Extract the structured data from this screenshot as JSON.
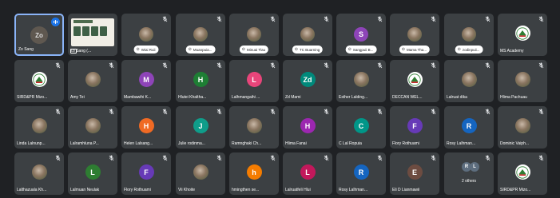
{
  "colors": {
    "background": "#1f2124",
    "tile": "#3c4043",
    "active_border": "#8ab4f8",
    "speaking": "#1a73e8"
  },
  "tiles": [
    {
      "id": "zo-sang",
      "label": "Zo Sang",
      "initials": "Zo",
      "avatar_color": "#5f5850",
      "kind": "initials",
      "state": "speaking",
      "active": true
    },
    {
      "id": "zo-sang-presentation",
      "label": "Zo Sang (...",
      "kind": "screen",
      "state": "none"
    },
    {
      "id": "wi-ai-rui",
      "label": "Wiai Ruii",
      "kind": "photo-pinned",
      "state": "muted"
    },
    {
      "id": "muanpuia",
      "label": "Muanpuia...",
      "kind": "photo-pinned",
      "state": "muted"
    },
    {
      "id": "minuai-tlau",
      "label": "Minuai Tlau",
      "kind": "photo-pinned",
      "state": "muted"
    },
    {
      "id": "tc-buarning",
      "label": "TC Buarning",
      "kind": "photo-pinned",
      "state": "muted"
    },
    {
      "id": "sangpuii",
      "label": "Sangpuii B...",
      "initials": "S",
      "avatar_color": "#8e44b8",
      "kind": "initials-pinned",
      "state": "muted"
    },
    {
      "id": "mama-tha",
      "label": "Mama Tha...",
      "kind": "photo-pinned",
      "state": "muted"
    },
    {
      "id": "zodinpuii",
      "label": "zodinpuii...",
      "kind": "photo-pinned",
      "state": "muted"
    },
    {
      "id": "ms-academy",
      "label": "MS Academy",
      "kind": "logo",
      "state": "muted"
    },
    {
      "id": "sirdpr-mizo",
      "label": "SIRD&PR Mizo...",
      "kind": "logo",
      "state": "muted"
    },
    {
      "id": "amy-tei",
      "label": "Amy Tei",
      "kind": "photo",
      "state": "muted"
    },
    {
      "id": "mambawihi",
      "label": "Mambawihi K...",
      "initials": "M",
      "avatar_color": "#8e44b8",
      "kind": "initials",
      "state": "muted"
    },
    {
      "id": "hlutei",
      "label": "Hlutei Khaltha...",
      "initials": "H",
      "avatar_color": "#1e7e34",
      "kind": "initials",
      "state": "muted"
    },
    {
      "id": "lalhmangaihi",
      "label": "Lalhmangaihi ...",
      "initials": "L",
      "avatar_color": "#e8457a",
      "kind": "initials",
      "state": "muted"
    },
    {
      "id": "zd-mami",
      "label": "Zd Mami",
      "initials": "Zd",
      "avatar_color": "#00897b",
      "kind": "initials",
      "state": "muted"
    },
    {
      "id": "esther",
      "label": "Esther Lalding...",
      "kind": "photo",
      "state": "muted"
    },
    {
      "id": "deccan",
      "label": "DECCAN WEL...",
      "kind": "logo",
      "state": "muted"
    },
    {
      "id": "lalruat-dika",
      "label": "Lalruat dika",
      "kind": "photo",
      "state": "muted"
    },
    {
      "id": "hlima-pachuau",
      "label": "Hlima Pachuau",
      "kind": "photo",
      "state": "muted"
    },
    {
      "id": "linda",
      "label": "Linda Lalnunp...",
      "kind": "photo",
      "state": "muted"
    },
    {
      "id": "lalramhluna",
      "label": "Lalramhluna P...",
      "kind": "photo",
      "state": "muted"
    },
    {
      "id": "helen",
      "label": "Helen Lalsang...",
      "initials": "H",
      "avatar_color": "#f06a24",
      "kind": "initials",
      "state": "muted"
    },
    {
      "id": "julie",
      "label": "Julie rodinma...",
      "initials": "J",
      "avatar_color": "#0f9d8a",
      "kind": "initials",
      "state": "muted"
    },
    {
      "id": "ramnghaki",
      "label": "Ramnghaki Ch...",
      "kind": "photo",
      "state": "muted"
    },
    {
      "id": "hlima-fanai",
      "label": "Hlima Fanai",
      "initials": "H",
      "avatar_color": "#9c27b0",
      "kind": "initials",
      "state": "muted"
    },
    {
      "id": "c-lal-ropuia",
      "label": "C Lal Ropuia",
      "initials": "C",
      "avatar_color": "#009688",
      "kind": "initials",
      "state": "muted"
    },
    {
      "id": "flory-rothuami",
      "label": "Flory Rothuami",
      "initials": "F",
      "avatar_color": "#673ab7",
      "kind": "initials",
      "state": "muted"
    },
    {
      "id": "rosy-lalhman",
      "label": "Rosy Lalhman...",
      "initials": "R",
      "avatar_color": "#1565c0",
      "kind": "initials",
      "state": "muted"
    },
    {
      "id": "dominic",
      "label": "Dominic Vaiph...",
      "kind": "photo",
      "state": "muted"
    },
    {
      "id": "lalthazuala",
      "label": "Lalthazuala Kh...",
      "kind": "photo",
      "state": "muted"
    },
    {
      "id": "lalmuan-neulak",
      "label": "Lalmuan Neulak",
      "initials": "L",
      "avatar_color": "#2e7d32",
      "kind": "initials",
      "state": "muted"
    },
    {
      "id": "flory-rothuami-2",
      "label": "Flory Rothuami",
      "initials": "F",
      "avatar_color": "#673ab7",
      "kind": "initials",
      "state": "muted"
    },
    {
      "id": "vii-khoite",
      "label": "Vii Khoite",
      "kind": "photo",
      "state": "muted"
    },
    {
      "id": "hmingthan",
      "label": "hmingthen se...",
      "initials": "h",
      "avatar_color": "#f57c00",
      "kind": "initials",
      "state": "muted"
    },
    {
      "id": "lalruatfeli",
      "label": "Lalruatfeli Hlui",
      "initials": "L",
      "avatar_color": "#c2185b",
      "kind": "initials",
      "state": "muted"
    },
    {
      "id": "rosy-lalhman-2",
      "label": "Rosy Lalhman...",
      "initials": "R",
      "avatar_color": "#1565c0",
      "kind": "initials",
      "state": "muted"
    },
    {
      "id": "eli-d",
      "label": "Eli D Lianmawii",
      "initials": "E",
      "avatar_color": "#6d4c41",
      "kind": "initials",
      "state": "muted"
    },
    {
      "id": "others",
      "label": "2 others",
      "kind": "others",
      "state": "muted",
      "others": [
        {
          "initials": "R",
          "color": "#5d6d7e"
        },
        {
          "initials": "L",
          "color": "#5d6d7e"
        }
      ]
    },
    {
      "id": "sirdpr-mizo-2",
      "label": "SIRD&PR Mizo...",
      "kind": "logo",
      "state": "muted"
    }
  ]
}
